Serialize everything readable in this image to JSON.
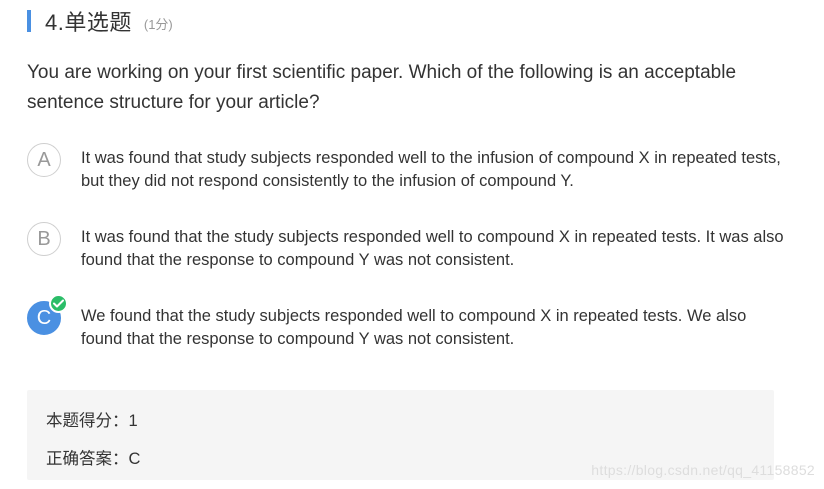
{
  "question": {
    "number_title": "4.单选题",
    "score": "(1分)",
    "text": "You are working on your first scientific paper. Which of the following is an acceptable sentence structure for your article?"
  },
  "options": [
    {
      "letter": "A",
      "text": "It was found that study subjects responded well to the infusion of compound X in repeated tests, but they did not respond consistently to the infusion of compound Y.",
      "selected_correct": false
    },
    {
      "letter": "B",
      "text": "It was found that the study subjects responded well to compound X in repeated tests. It was also found that the response to compound Y was not consistent.",
      "selected_correct": false
    },
    {
      "letter": "C",
      "text": "We found that the study subjects responded well to compound X in repeated tests. We also found that the response to compound Y was not consistent.",
      "selected_correct": true,
      "badge_icon": "check-circle-icon"
    }
  ],
  "result": {
    "score_line": "本题得分：1",
    "answer_line": "正确答案：C"
  },
  "watermark": "https://blog.csdn.net/qq_41158852",
  "colors": {
    "accent": "#4a90e2",
    "correct_badge": "#2bbd68",
    "result_bg": "#f5f5f5"
  }
}
